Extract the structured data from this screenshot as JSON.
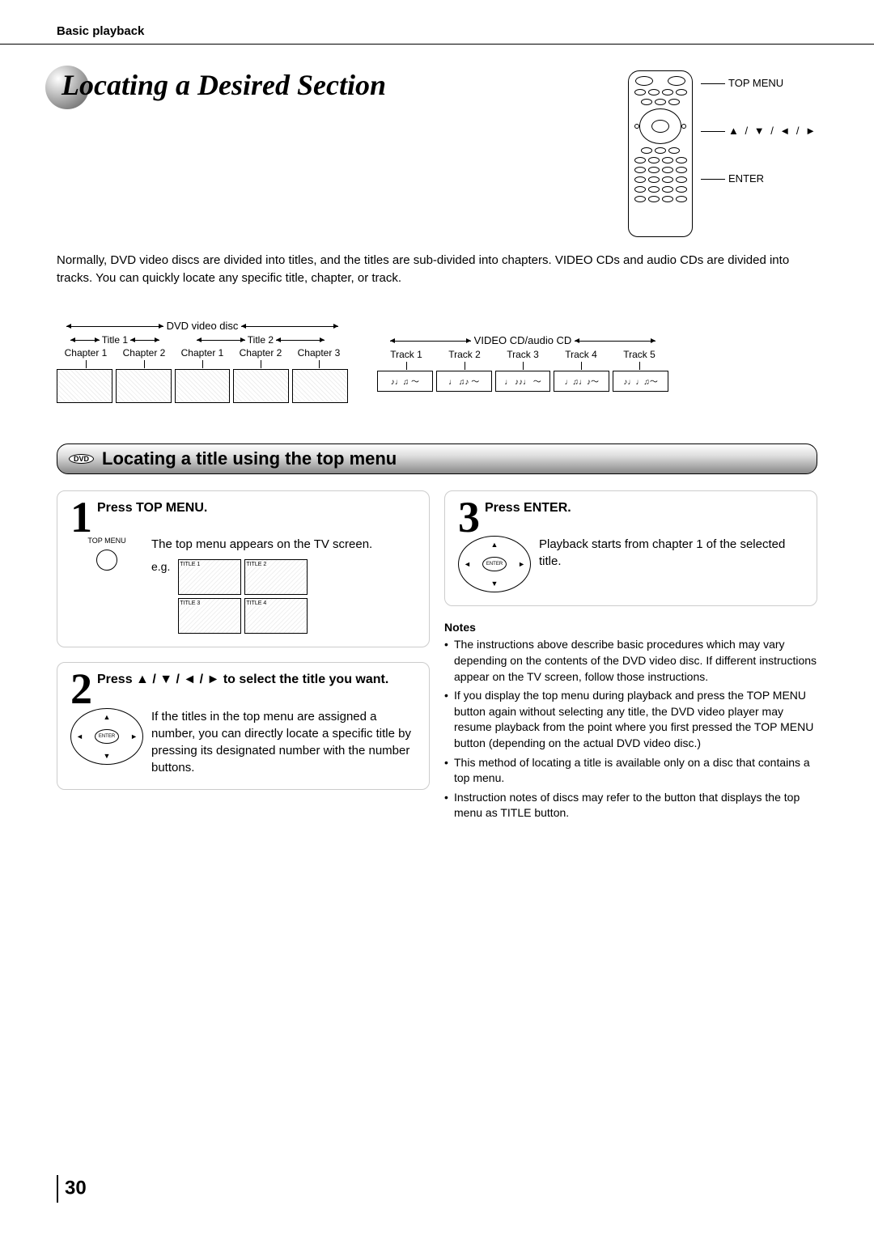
{
  "section_tag": "Basic playback",
  "main_title": "Locating a Desired Section",
  "remote_labels": {
    "top_menu": "TOP MENU",
    "arrows": "▲ / ▼ / ◄ / ►",
    "enter": "ENTER"
  },
  "intro": "Normally, DVD video discs are divided into titles, and the titles are sub-divided into chapters. VIDEO CDs and audio CDs are divided into tracks. You can quickly locate any specific title, chapter, or track.",
  "dvd_diagram": {
    "label": "DVD video disc",
    "titles": [
      "Title 1",
      "Title 2"
    ],
    "chapters_t1": [
      "Chapter 1",
      "Chapter 2"
    ],
    "chapters_t2": [
      "Chapter 1",
      "Chapter 2",
      "Chapter 3"
    ]
  },
  "cd_diagram": {
    "label": "VIDEO CD/audio CD",
    "tracks": [
      "Track 1",
      "Track 2",
      "Track 3",
      "Track 4",
      "Track 5"
    ],
    "glyphs": [
      "♪♩♫  ～",
      "♩ ♫♪ ～",
      "♩ ♪♪♩ ～",
      "♩♫♩♪～",
      "♪♩♩♫～"
    ]
  },
  "subsection": {
    "badge": "DVD",
    "title": "Locating a title using the top menu"
  },
  "steps": {
    "s1": {
      "num": "1",
      "title": "Press TOP MENU.",
      "icon_label": "TOP MENU",
      "body": "The top menu appears on the TV screen.",
      "eg": "e.g.",
      "tiles": [
        "TITLE 1",
        "TITLE 2",
        "TITLE 3",
        "TITLE 4"
      ]
    },
    "s2": {
      "num": "2",
      "title": "Press ▲ / ▼ / ◄ / ► to select the title you want.",
      "enter": "ENTER",
      "body": "If the titles in the top menu are assigned a number, you can directly locate a specific title by pressing its designated number with the number buttons."
    },
    "s3": {
      "num": "3",
      "title": "Press ENTER.",
      "enter": "ENTER",
      "body": "Playback starts from chapter 1 of the selected title."
    }
  },
  "notes": {
    "title": "Notes",
    "items": [
      "The instructions above describe basic procedures which may vary depending on the contents of the DVD video disc. If different instructions appear on the TV screen, follow those instructions.",
      "If you display the top menu during playback and press the TOP MENU button again without selecting any title, the DVD video player may resume playback from the point where you first pressed the TOP MENU button (depending on the actual DVD video disc.)",
      "This method of locating a title is available only on a disc that contains a top menu.",
      "Instruction notes of discs may refer to the button that displays the top menu as TITLE button."
    ]
  },
  "page_number": "30"
}
